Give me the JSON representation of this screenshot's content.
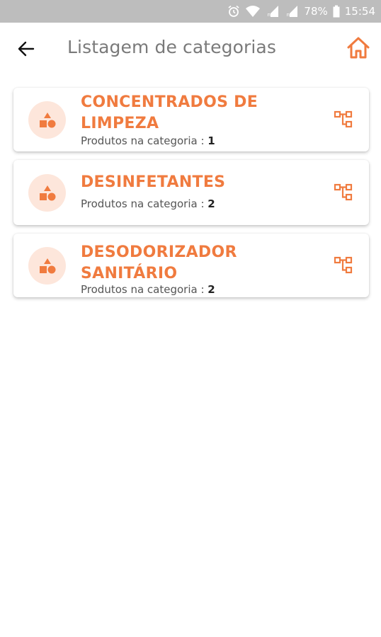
{
  "status_bar": {
    "battery": "78%",
    "time": "15:54",
    "icons": [
      "alarm-icon",
      "wifi-icon",
      "signal-icon",
      "signal-icon",
      "battery-icon"
    ]
  },
  "header": {
    "title": "Listagem de categorias",
    "back_icon": "arrow-left-icon",
    "home_icon": "home-icon"
  },
  "colors": {
    "accent": "#f07b3f",
    "icon_bg": "#fde6db",
    "status_bar": "#bdbdbd"
  },
  "categories": [
    {
      "name": "CONCENTRADOS DE LIMPEZA",
      "count_label": "Produtos na categoria : ",
      "count": "1",
      "icon": "shapes-icon",
      "action_icon": "subcategory-tree-icon"
    },
    {
      "name": "DESINFETANTES",
      "count_label": "Produtos na categoria : ",
      "count": "2",
      "icon": "shapes-icon",
      "action_icon": "subcategory-tree-icon"
    },
    {
      "name": "DESODORIZADOR SANITÁRIO",
      "count_label": "Produtos na categoria : ",
      "count": "2",
      "icon": "shapes-icon",
      "action_icon": "subcategory-tree-icon"
    }
  ]
}
